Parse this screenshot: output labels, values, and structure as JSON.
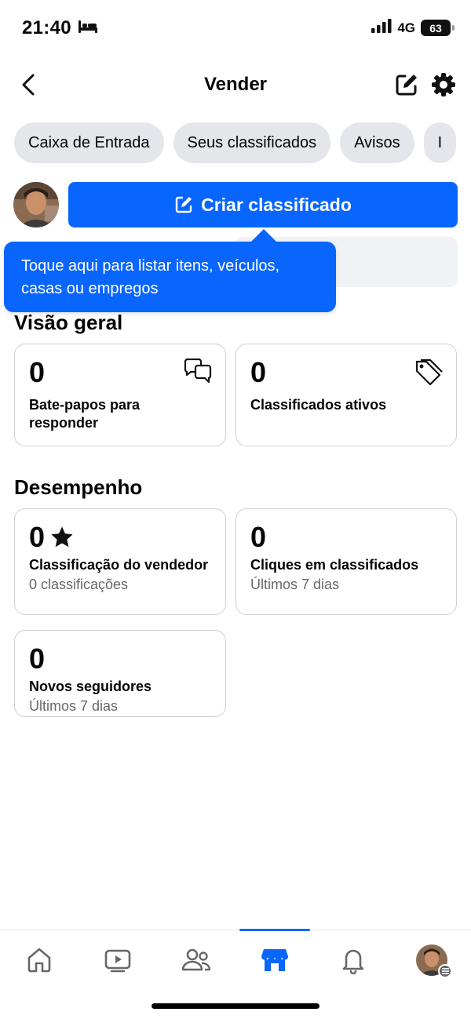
{
  "status_bar": {
    "time": "21:40",
    "network": "4G",
    "battery": "63"
  },
  "header": {
    "title": "Vender"
  },
  "tabs": [
    {
      "label": "Caixa de Entrada"
    },
    {
      "label": "Seus classificados"
    },
    {
      "label": "Avisos"
    },
    {
      "label": "I"
    }
  ],
  "create": {
    "button_label": "Criar classificado"
  },
  "tooltip": {
    "text": "Toque aqui para listar itens, veículos, casas ou empregos"
  },
  "overview": {
    "title": "Visão geral",
    "cards": [
      {
        "value": "0",
        "label": "Bate-papos para responder",
        "icon": "chat-bubbles-icon"
      },
      {
        "value": "0",
        "label": "Classificados ativos",
        "icon": "price-tag-icon"
      }
    ]
  },
  "performance": {
    "title": "Desempenho",
    "cards": [
      {
        "value": "0",
        "label": "Classificação do vendedor",
        "sub": "0 classificações",
        "icon": "star-icon"
      },
      {
        "value": "0",
        "label": "Cliques em classificados",
        "sub": "Últimos 7 dias"
      },
      {
        "value": "0",
        "label": "Novos seguidores",
        "sub": "Últimos 7 dias"
      }
    ]
  },
  "bottom_nav": {
    "items": [
      "home-icon",
      "video-icon",
      "friends-icon",
      "marketplace-icon",
      "notifications-icon",
      "profile-avatar"
    ],
    "active": "marketplace-icon"
  },
  "colors": {
    "accent": "#0866ff",
    "chip_bg": "#e4e6eb",
    "border": "#ced0d4",
    "secondary_text": "#65676b"
  }
}
